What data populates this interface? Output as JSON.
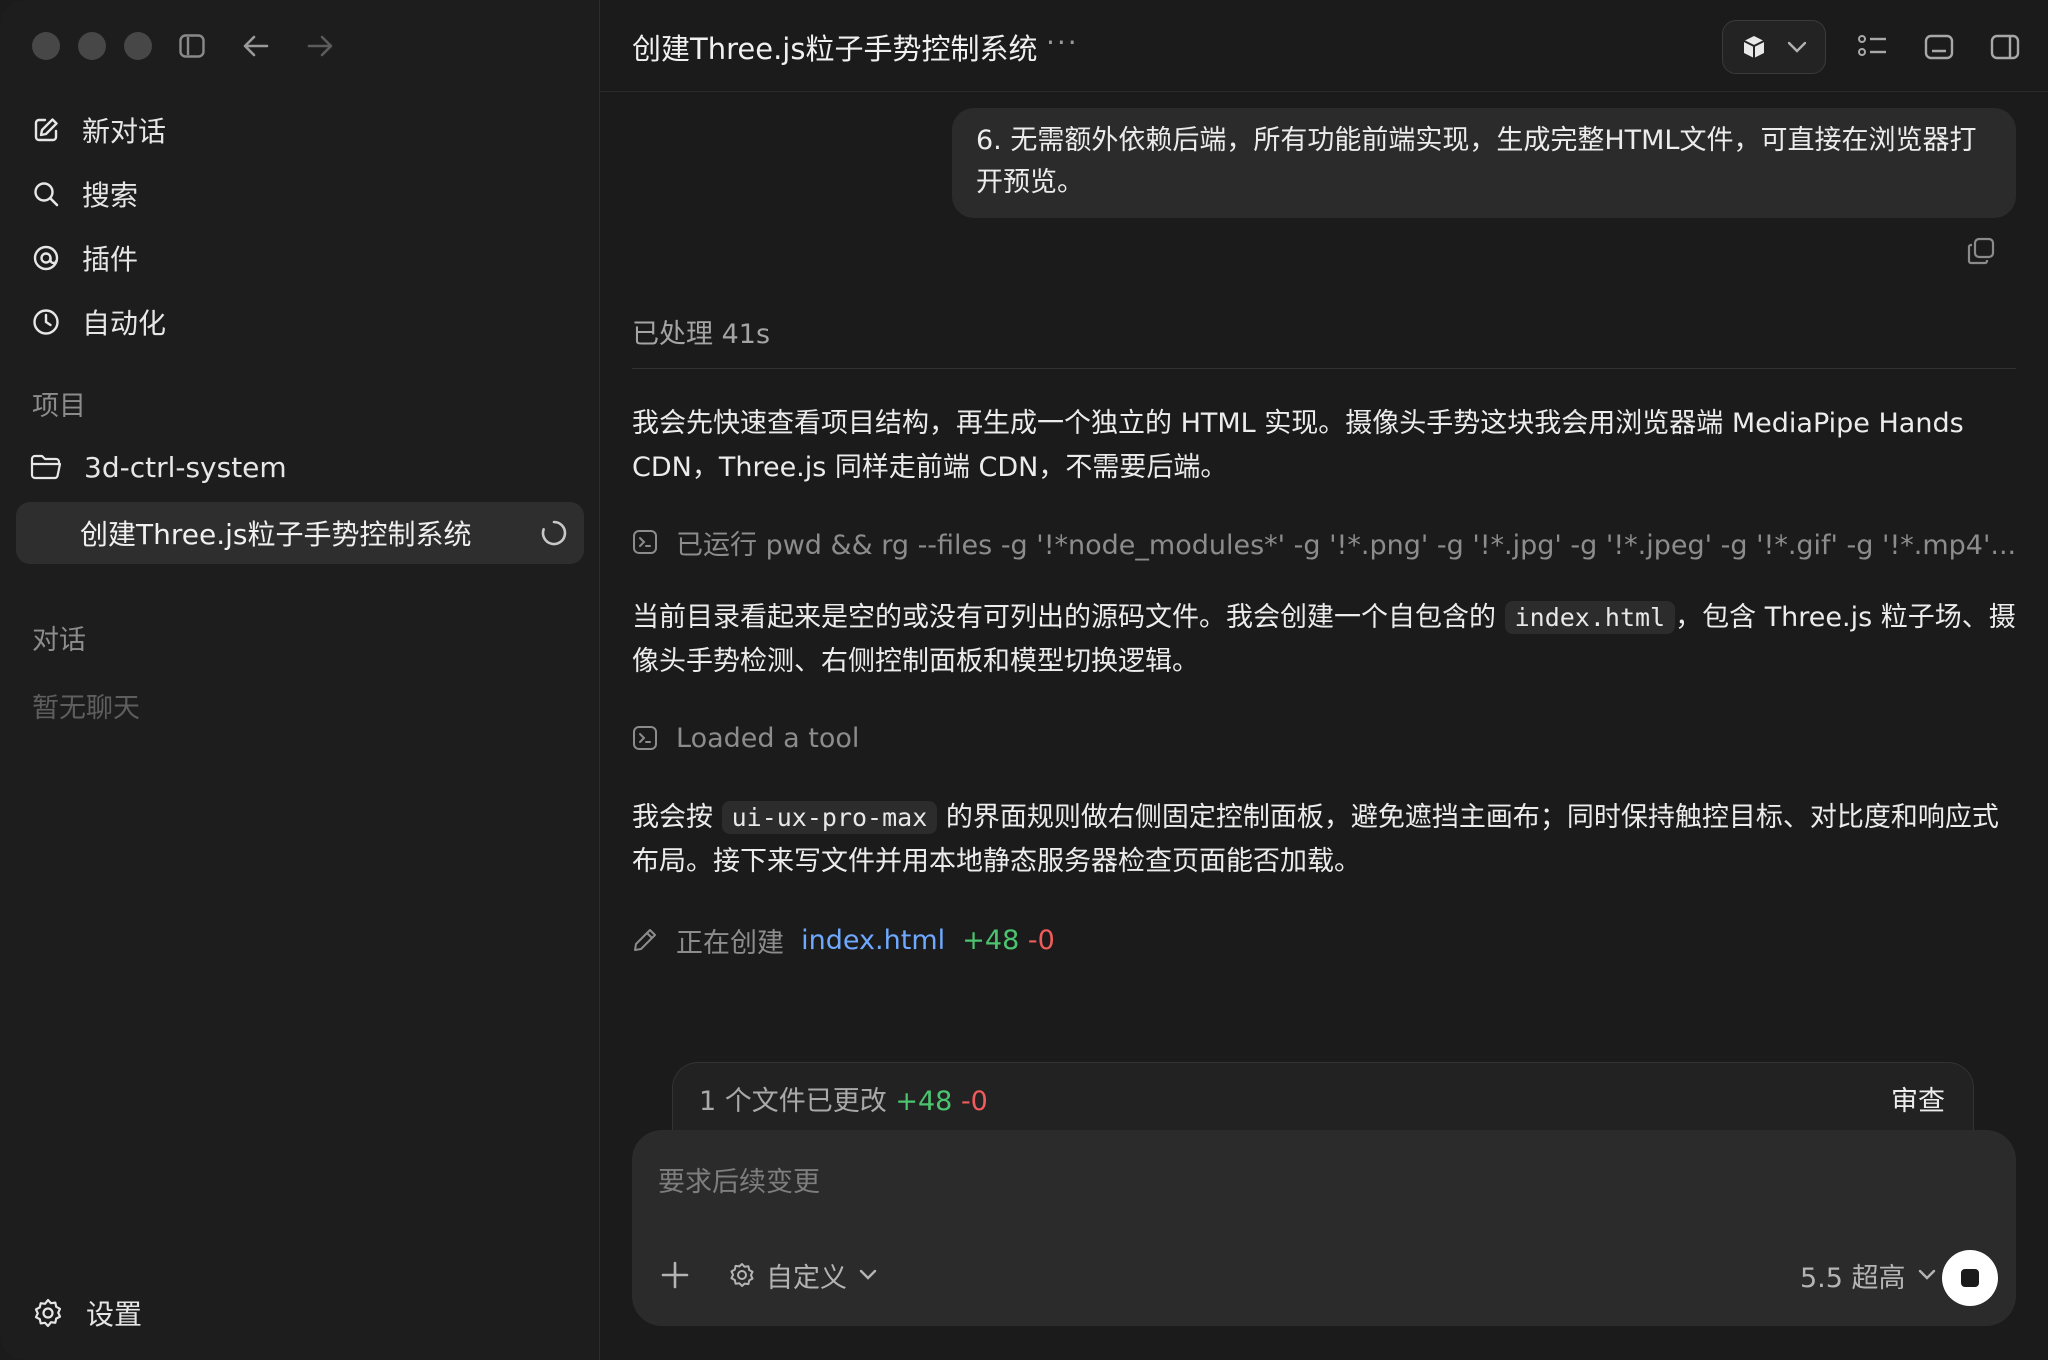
{
  "sidebar": {
    "nav": [
      {
        "label": "新对话",
        "icon": "compose-icon"
      },
      {
        "label": "搜索",
        "icon": "search-icon"
      },
      {
        "label": "插件",
        "icon": "plugin-icon"
      },
      {
        "label": "自动化",
        "icon": "clock-icon"
      }
    ],
    "projects_label": "项目",
    "project_name": "3d-ctrl-system",
    "active_chat": "创建Three.js粒子手势控制系统",
    "chats_label": "对话",
    "empty_chats": "暂无聊天",
    "settings": "设置"
  },
  "header": {
    "title": "创建Three.js粒子手势控制系统",
    "more": "···"
  },
  "conversation": {
    "user_message": "6. 无需额外依赖后端，所有功能前端实现，生成完整HTML文件，可直接在浏览器打开预览。",
    "processed": "已处理 41s",
    "para1": "我会先快速查看项目结构，再生成一个独立的 HTML 实现。摄像头手势这块我会用浏览器端 MediaPipe Hands CDN，Three.js 同样走前端 CDN，不需要后端。",
    "tool_ran": "已运行 pwd && rg --files -g '!*node_modules*' -g '!*.png' -g '!*.jpg' -g '!*.jpeg' -g '!*.gif' -g '!*.mp4'...",
    "para2_a": "当前目录看起来是空的或没有可列出的源码文件。我会创建一个自包含的 ",
    "para2_code": "index.html",
    "para2_b": "，包含 Three.js 粒子场、摄像头手势检测、右侧控制面板和模型切换逻辑。",
    "tool_loaded": "Loaded a tool",
    "para3_a": "我会按 ",
    "para3_code": "ui-ux-pro-max",
    "para3_b": " 的界面规则做右侧固定控制面板，避免遮挡主画布；同时保持触控目标、对比度和响应式布局。接下来写文件并用本地静态服务器检查页面能否加载。",
    "creating_label": "正在创建",
    "creating_file": "index.html",
    "creating_add": "+48",
    "creating_del": "-0"
  },
  "changes": {
    "label": "1 个文件已更改",
    "add": "+48",
    "del": "-0",
    "review": "审查"
  },
  "composer": {
    "placeholder": "要求后续变更",
    "mode": "自定义",
    "model": "5.5 超高"
  },
  "colors": {
    "accent_blue": "#6ea8ff",
    "add_green": "#4cc46f",
    "del_red": "#f05b5b"
  }
}
